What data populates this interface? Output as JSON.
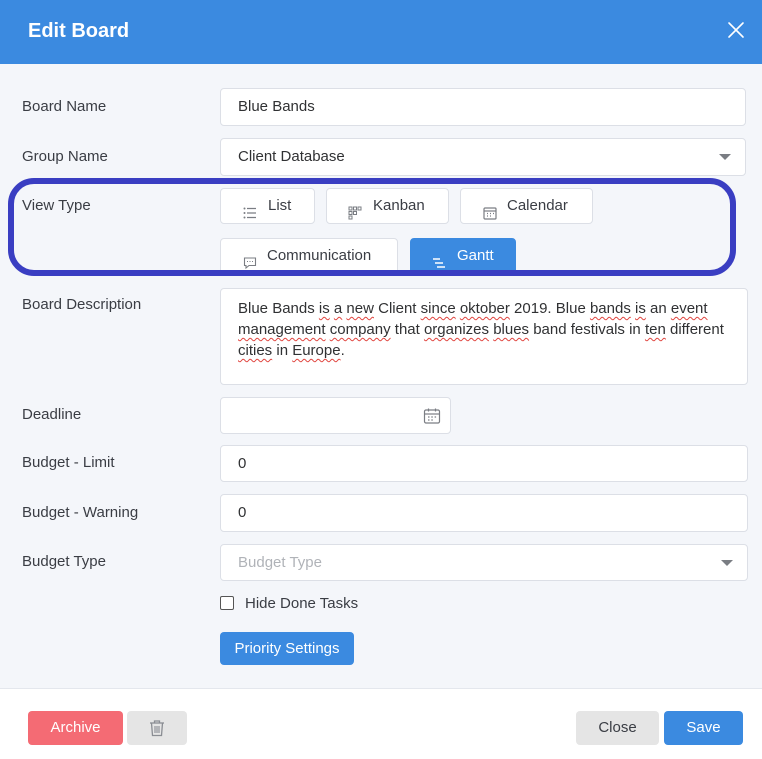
{
  "header": {
    "title": "Edit Board",
    "close_icon": "close-icon"
  },
  "form": {
    "board_name": {
      "label": "Board Name",
      "value": "Blue Bands"
    },
    "group_name": {
      "label": "Group Name",
      "value": "Client Database"
    },
    "view_type": {
      "label": "View Type",
      "options": [
        {
          "label": "List",
          "icon": "list-icon",
          "active": false
        },
        {
          "label": "Kanban",
          "icon": "kanban-icon",
          "active": false
        },
        {
          "label": "Calendar",
          "icon": "calendar-icon",
          "active": false
        },
        {
          "label": "Communication",
          "icon": "chat-icon",
          "active": false
        },
        {
          "label": "Gantt",
          "icon": "gantt-icon",
          "active": true
        }
      ]
    },
    "board_description": {
      "label": "Board Description",
      "value": "Blue Bands is a new Client since oktober 2019. Blue bands is an event management company that organizes blues band festivals in ten different cities in Europe."
    },
    "deadline": {
      "label": "Deadline",
      "value": ""
    },
    "budget_limit": {
      "label": "Budget - Limit",
      "value": "0"
    },
    "budget_warning": {
      "label": "Budget - Warning",
      "value": "0"
    },
    "budget_type": {
      "label": "Budget Type",
      "placeholder": "Budget Type"
    },
    "hide_done_tasks": {
      "label": "Hide Done Tasks",
      "checked": false
    },
    "priority_settings_label": "Priority Settings"
  },
  "footer": {
    "archive_label": "Archive",
    "close_label": "Close",
    "save_label": "Save"
  },
  "colors": {
    "header": "#3b8ae0",
    "primary": "#3b8ae0",
    "danger": "#f46b74",
    "highlight_ring": "#3a3ec2"
  }
}
